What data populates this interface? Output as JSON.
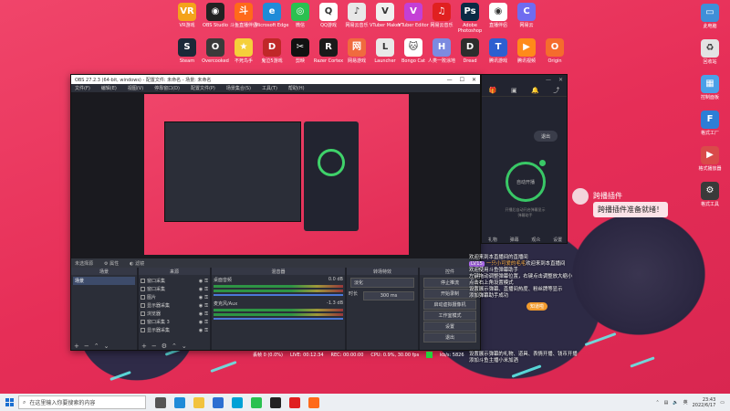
{
  "desktop_icons_top": [
    {
      "label": "VR游戏",
      "icon": "vr-game-icon",
      "color": "#f4a31b",
      "glyph": "VR"
    },
    {
      "label": "OBS Studio",
      "icon": "obs-icon",
      "color": "#222222",
      "glyph": "◉"
    },
    {
      "label": "斗鱼直播伴侣",
      "icon": "douyu-icon",
      "color": "#ff6a1a",
      "glyph": "斗"
    },
    {
      "label": "Microsoft Edge",
      "icon": "edge-icon",
      "color": "#1f8bd8",
      "glyph": "e"
    },
    {
      "label": "微信",
      "icon": "wechat-icon",
      "color": "#2ac150",
      "glyph": "◎"
    },
    {
      "label": "QQ游戏",
      "icon": "qq-game-icon",
      "color": "#ffffff",
      "glyph": "Q"
    },
    {
      "label": "网易云音乐",
      "icon": "netease-icon",
      "color": "#e8e8e8",
      "glyph": "♪"
    },
    {
      "label": "VTuber Maker",
      "icon": "vtuber-maker-icon",
      "color": "#f0f0f0",
      "glyph": "V"
    },
    {
      "label": "VTuber Editor",
      "icon": "vtuber-editor-icon",
      "color": "#c43fd6",
      "glyph": "V"
    },
    {
      "label": "网易云音乐",
      "icon": "netease-music-icon",
      "color": "#e02020",
      "glyph": "♫"
    },
    {
      "label": "Adobe Photoshop",
      "icon": "photoshop-icon",
      "color": "#0a2a44",
      "glyph": "Ps"
    },
    {
      "label": "直播伴侣",
      "icon": "live-companion-icon",
      "color": "#ffffff",
      "glyph": "◉"
    },
    {
      "label": "网易云",
      "icon": "netease-cloud-icon",
      "color": "#6f6cf0",
      "glyph": "C"
    }
  ],
  "desktop_icons_row2": [
    {
      "label": "Steam",
      "icon": "steam-icon",
      "color": "#1b2838",
      "glyph": "S"
    },
    {
      "label": "Overcooked",
      "icon": "overcooked-icon",
      "color": "#3a3a3a",
      "glyph": "O"
    },
    {
      "label": "不死鸟手",
      "icon": "game-icon",
      "color": "#f5d03a",
      "glyph": "★"
    },
    {
      "label": "鬼泣5游戏",
      "icon": "game2-icon",
      "color": "#c02828",
      "glyph": "D"
    },
    {
      "label": "剪映",
      "icon": "capcut-icon",
      "color": "#111111",
      "glyph": "✂"
    },
    {
      "label": "Razer Cortex",
      "icon": "razer-icon",
      "color": "#1a1a1a",
      "glyph": "R"
    },
    {
      "label": "网易游戏",
      "icon": "netease-game-icon",
      "color": "#f06b3e",
      "glyph": "网"
    },
    {
      "label": "Launcher",
      "icon": "launcher-icon",
      "color": "#e8e8e8",
      "glyph": "L"
    },
    {
      "label": "Bongo Cat",
      "icon": "bongo-cat-icon",
      "color": "#ffffff",
      "glyph": "🐱"
    },
    {
      "label": "人类一败涂地",
      "icon": "human-fall-icon",
      "color": "#7c8ae0",
      "glyph": "H"
    },
    {
      "label": "Dread",
      "icon": "dread-icon",
      "color": "#2d2d2d",
      "glyph": "D"
    },
    {
      "label": "腾讯游戏",
      "icon": "tencent-game-icon",
      "color": "#2d5fd0",
      "glyph": "T"
    },
    {
      "label": "腾讯视频",
      "icon": "tencent-video-icon",
      "color": "#ff8a1a",
      "glyph": "▶"
    },
    {
      "label": "Origin",
      "icon": "origin-icon",
      "color": "#f56c2d",
      "glyph": "O"
    }
  ],
  "desktop_icons_right": [
    {
      "label": "此电脑",
      "icon": "this-pc-icon",
      "color": "#3f8fd8",
      "glyph": "▭"
    },
    {
      "label": "回收站",
      "icon": "recycle-bin-icon",
      "color": "#e3e3e3",
      "glyph": "♻"
    },
    {
      "label": "控制面板",
      "icon": "control-panel-icon",
      "color": "#4aa0e8",
      "glyph": "▦"
    },
    {
      "label": "格式工厂",
      "icon": "format-factory-icon",
      "color": "#2d7ed6",
      "glyph": "F"
    },
    {
      "label": "格式播放器",
      "icon": "player-icon",
      "color": "#d94a4a",
      "glyph": "▶"
    },
    {
      "label": "格式工具",
      "icon": "tool-icon",
      "color": "#3a3a3a",
      "glyph": "⚙"
    }
  ],
  "obs": {
    "title": "OBS 27.2.3 (64-bit, windows) - 配置文件: 未命名 - 场景: 未命名",
    "menu": [
      "文件(F)",
      "编辑(E)",
      "视图(V)",
      "停靠窗口(D)",
      "配置文件(P)",
      "场景集合(S)",
      "工具(T)",
      "帮助(H)"
    ],
    "scene_bar": [
      "未选择源",
      "属性",
      "滤镜"
    ],
    "docks": {
      "scenes": {
        "title": "场景",
        "items": [
          "场景"
        ]
      },
      "sources": {
        "title": "来源",
        "items": [
          "窗口采集",
          "窗口采集",
          "图片",
          "显示器采集",
          "浏览器",
          "窗口采集 3",
          "显示器采集"
        ]
      },
      "mixer": {
        "title": "混音器",
        "tracks": [
          {
            "name": "桌面音频",
            "level": "0.0 dB"
          },
          {
            "name": "麦克风/Aux",
            "level": "-1.3 dB"
          }
        ]
      },
      "transitions": {
        "title": "转场特效",
        "type": "淡化",
        "duration_label": "时长",
        "duration": "300 ms"
      },
      "controls": {
        "title": "控件",
        "buttons": [
          "停止推流",
          "开始录制",
          "启动虚拟摄像机",
          "工作室模式",
          "设置",
          "退出"
        ]
      }
    },
    "status": {
      "dropped": "丢帧 0 (0.0%)",
      "live": "LIVE: 00:12:34",
      "rec": "REC: 00:00:00",
      "cpu": "CPU: 0.9%, 30.00 fps",
      "kbps": "kb/s: 5826"
    }
  },
  "assistant_panel": {
    "exit_label": "退出",
    "ring_label": "自动开播",
    "sub1": "开播后自动开启弹幕显示",
    "sub2": "弹幕助手",
    "tabs": [
      "礼物",
      "弹幕",
      "观众",
      "设置"
    ]
  },
  "plugin": {
    "title": "跨播插件",
    "message": "跨播插件准备就绪！"
  },
  "chat": {
    "lines": [
      {
        "text": "欢迎来到本直播间的直播间"
      },
      {
        "tag": "LV15",
        "name": "一只小可爱的毛毛",
        "text": "欢迎来到本直播间"
      },
      {
        "text": "欢迎使用斗鱼弹幕助手"
      },
      {
        "text": "左键拖动调整弹幕位置，右键点击调整放大缩小"
      },
      {
        "text": "点击右上角设置模式"
      },
      {
        "text": "设置展示弹幕、直播间热度、粉丝牌等显示"
      },
      {
        "text": "添加弹幕助手成功"
      }
    ],
    "ok_label": "知道啦",
    "bottom_lines": [
      "设置展示弹幕的礼物、道具、表情开播、钱币开播",
      "添加斗鱼主播小米加酒"
    ]
  },
  "taskbar": {
    "search_placeholder": "在这里输入你要搜索的内容",
    "apps": [
      {
        "icon": "task-view-icon",
        "color": "#555555"
      },
      {
        "icon": "edge-icon",
        "color": "#1f8bd8"
      },
      {
        "icon": "file-explorer-icon",
        "color": "#f2c33d"
      },
      {
        "icon": "store-icon",
        "color": "#2d6fd1"
      },
      {
        "icon": "bilibili-icon",
        "color": "#00a1d6"
      },
      {
        "icon": "wechat-icon",
        "color": "#2ac150"
      },
      {
        "icon": "obs-icon",
        "color": "#222222"
      },
      {
        "icon": "netease-music-icon",
        "color": "#e02020"
      },
      {
        "icon": "douyu-icon",
        "color": "#ff6a1a"
      }
    ],
    "time": "23:43",
    "date": "2022/6/17"
  }
}
